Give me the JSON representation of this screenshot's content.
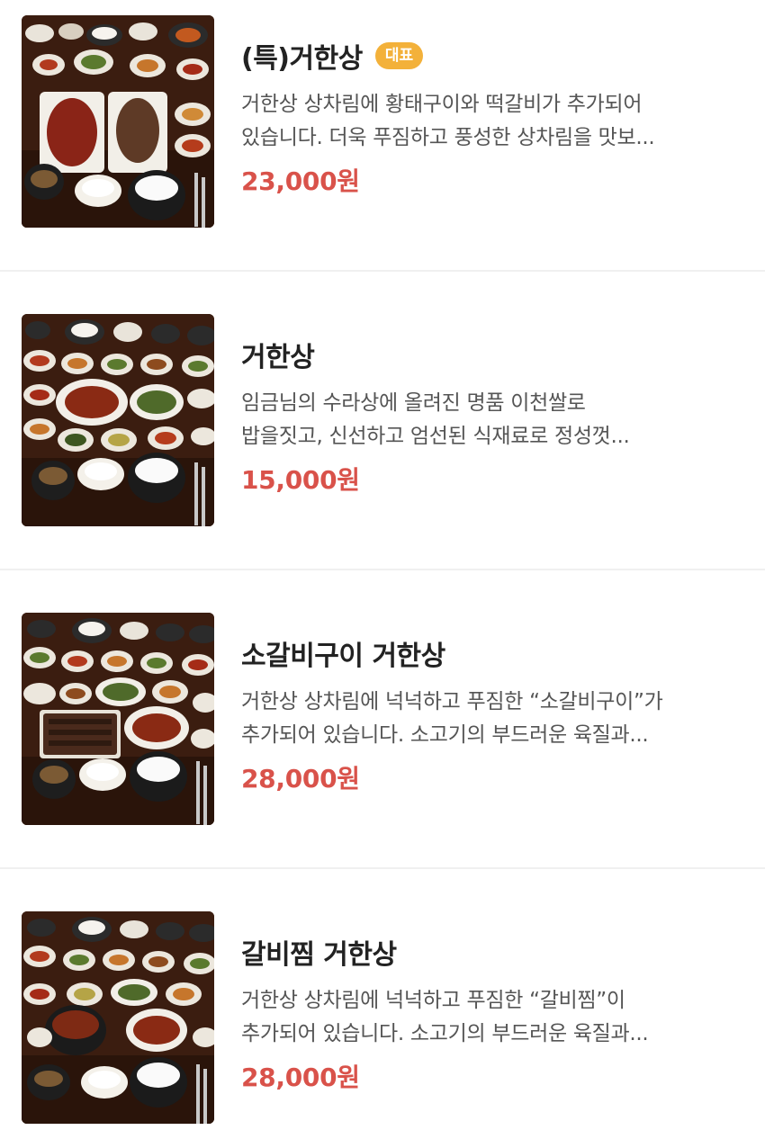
{
  "menu": {
    "items": [
      {
        "title": "(특)거한상",
        "badge": "대표",
        "desc_line1": "거한상 상차림에 황태구이와 떡갈비가 추가되어",
        "desc_line2": "있습니다. 더욱 푸짐하고 풍성한 상차림을 맛보...",
        "price": "23,000원"
      },
      {
        "title": "거한상",
        "desc_line1": "임금님의 수라상에 올려진 명품 이천쌀로",
        "desc_line2": "밥을짓고, 신선하고 엄선된 식재료로 정성껏...",
        "price": "15,000원"
      },
      {
        "title": "소갈비구이 거한상",
        "desc_line1": "거한상 상차림에 넉넉하고 푸짐한 “소갈비구이”가",
        "desc_line2": "추가되어 있습니다. 소고기의 부드러운 육질과...",
        "price": "28,000원"
      },
      {
        "title": "갈비찜 거한상",
        "desc_line1": "거한상 상차림에 넉넉하고 푸짐한 “갈비찜”이",
        "desc_line2": "추가되어 있습니다. 소고기의 부드러운 육질과...",
        "price": "28,000원"
      }
    ]
  },
  "colors": {
    "price": "#d9524a",
    "badge": "#f3b13a",
    "title": "#222222",
    "description": "#555555",
    "divider": "#f0f0f0"
  }
}
